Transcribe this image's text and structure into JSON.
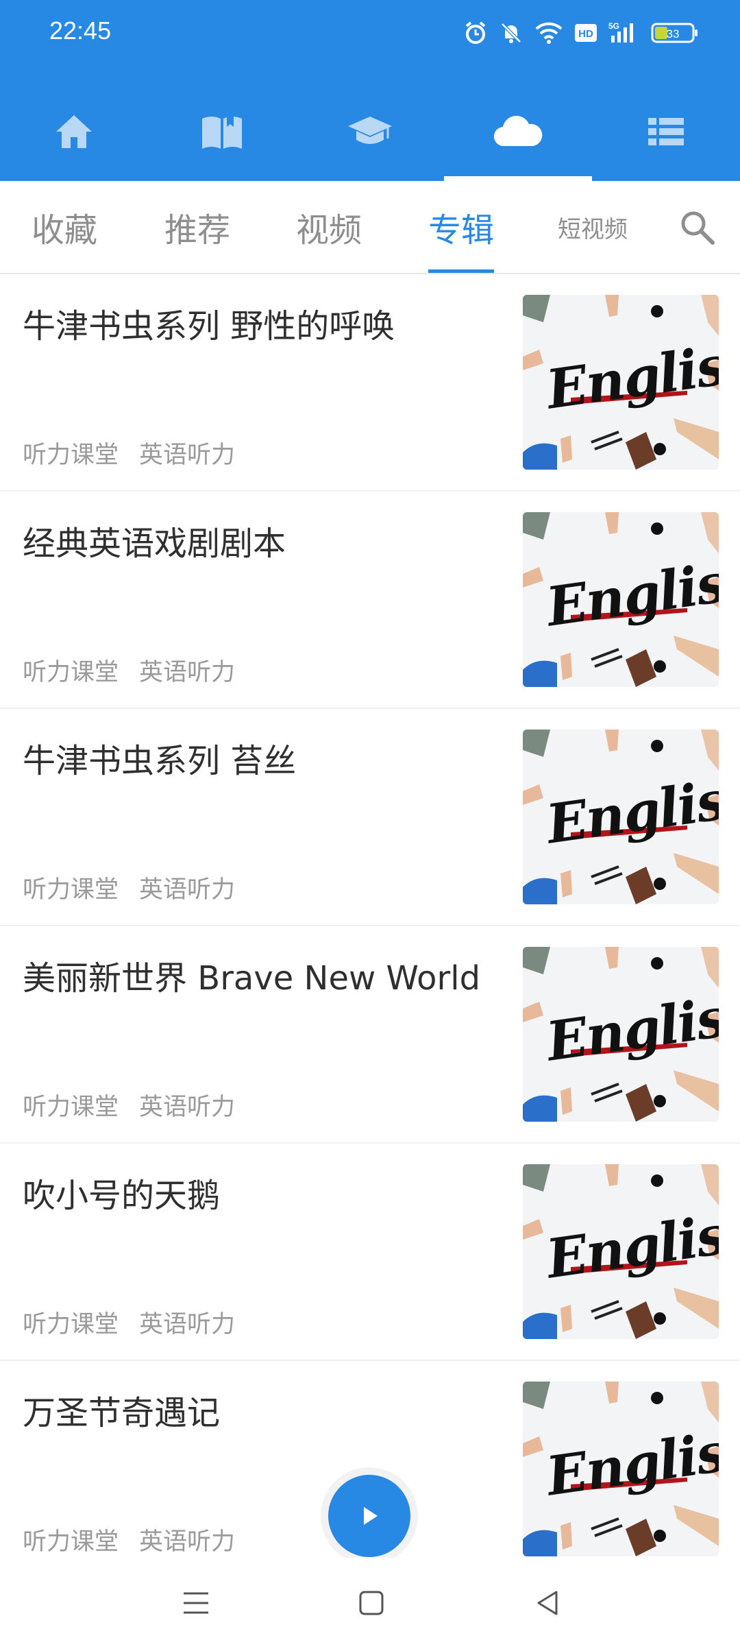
{
  "status": {
    "time": "22:45",
    "battery": "33",
    "icons": [
      "alarm-icon",
      "mute-icon",
      "wifi-icon",
      "hd-icon",
      "signal-5g-icon",
      "battery-icon"
    ]
  },
  "top_nav": {
    "items": [
      {
        "icon": "home-icon"
      },
      {
        "icon": "book-icon"
      },
      {
        "icon": "graduation-cap-icon"
      },
      {
        "icon": "cloud-icon",
        "active": true
      },
      {
        "icon": "list-icon"
      }
    ]
  },
  "tabs": {
    "items": [
      {
        "label": "收藏"
      },
      {
        "label": "推荐"
      },
      {
        "label": "视频"
      },
      {
        "label": "专辑",
        "active": true
      },
      {
        "label": "短视频"
      }
    ],
    "search_icon": "search-icon"
  },
  "albums": [
    {
      "title": "牛津书虫系列 野性的呼唤",
      "tags": [
        "听力课堂",
        "英语听力"
      ],
      "thumb_text": "English"
    },
    {
      "title": "经典英语戏剧剧本",
      "tags": [
        "听力课堂",
        "英语听力"
      ],
      "thumb_text": "English"
    },
    {
      "title": "牛津书虫系列 苔丝",
      "tags": [
        "听力课堂",
        "英语听力"
      ],
      "thumb_text": "English"
    },
    {
      "title": "美丽新世界 Brave New World",
      "tags": [
        "听力课堂",
        "英语听力"
      ],
      "thumb_text": "English"
    },
    {
      "title": "吹小号的天鹅",
      "tags": [
        "听力课堂",
        "英语听力"
      ],
      "thumb_text": "English"
    },
    {
      "title": "万圣节奇遇记",
      "tags": [
        "听力课堂",
        "英语听力"
      ],
      "thumb_text": "English"
    }
  ],
  "colors": {
    "primary": "#2789e3",
    "text": "#2f2f2f",
    "muted": "#9a9a9a"
  }
}
